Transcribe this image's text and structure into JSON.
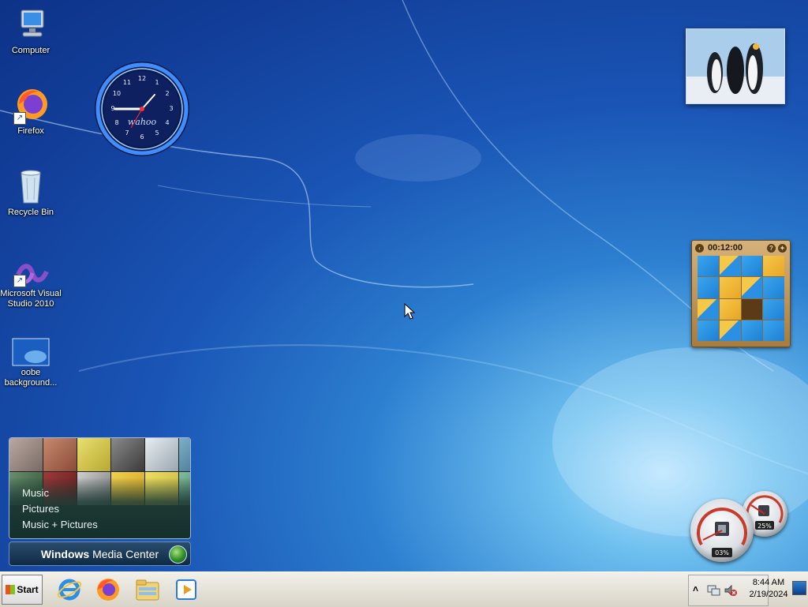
{
  "desktop": {
    "icons": [
      {
        "label": "Computer",
        "icon": "computer-icon"
      },
      {
        "label": "Firefox",
        "icon": "firefox-icon"
      },
      {
        "label": "Recycle Bin",
        "icon": "recycle-bin-icon"
      },
      {
        "label": "Microsoft Visual Studio 2010",
        "icon": "visual-studio-icon"
      },
      {
        "label": "oobe background...",
        "icon": "image-file-icon"
      }
    ]
  },
  "gadgets": {
    "clock": {
      "brand": "wahoo",
      "time": "8:44",
      "numerals": [
        "12",
        "1",
        "2",
        "3",
        "4",
        "5",
        "6",
        "7",
        "8",
        "9",
        "10",
        "11"
      ]
    },
    "puzzle": {
      "timer": "00:12:00"
    },
    "media_center": {
      "items": [
        "Music",
        "Pictures",
        "Music + Pictures"
      ],
      "title_bold": "Windows",
      "title_light": " Media Center"
    },
    "cpu_meter": {
      "cpu_percent": "03%",
      "memory_percent": "25%"
    }
  },
  "taskbar": {
    "start_label": "Start",
    "pinned": [
      "internet-explorer-icon",
      "firefox-icon",
      "file-explorer-icon",
      "media-player-icon"
    ],
    "tray_arrow": "˄",
    "time": "8:44 AM",
    "date": "2/19/2024"
  }
}
